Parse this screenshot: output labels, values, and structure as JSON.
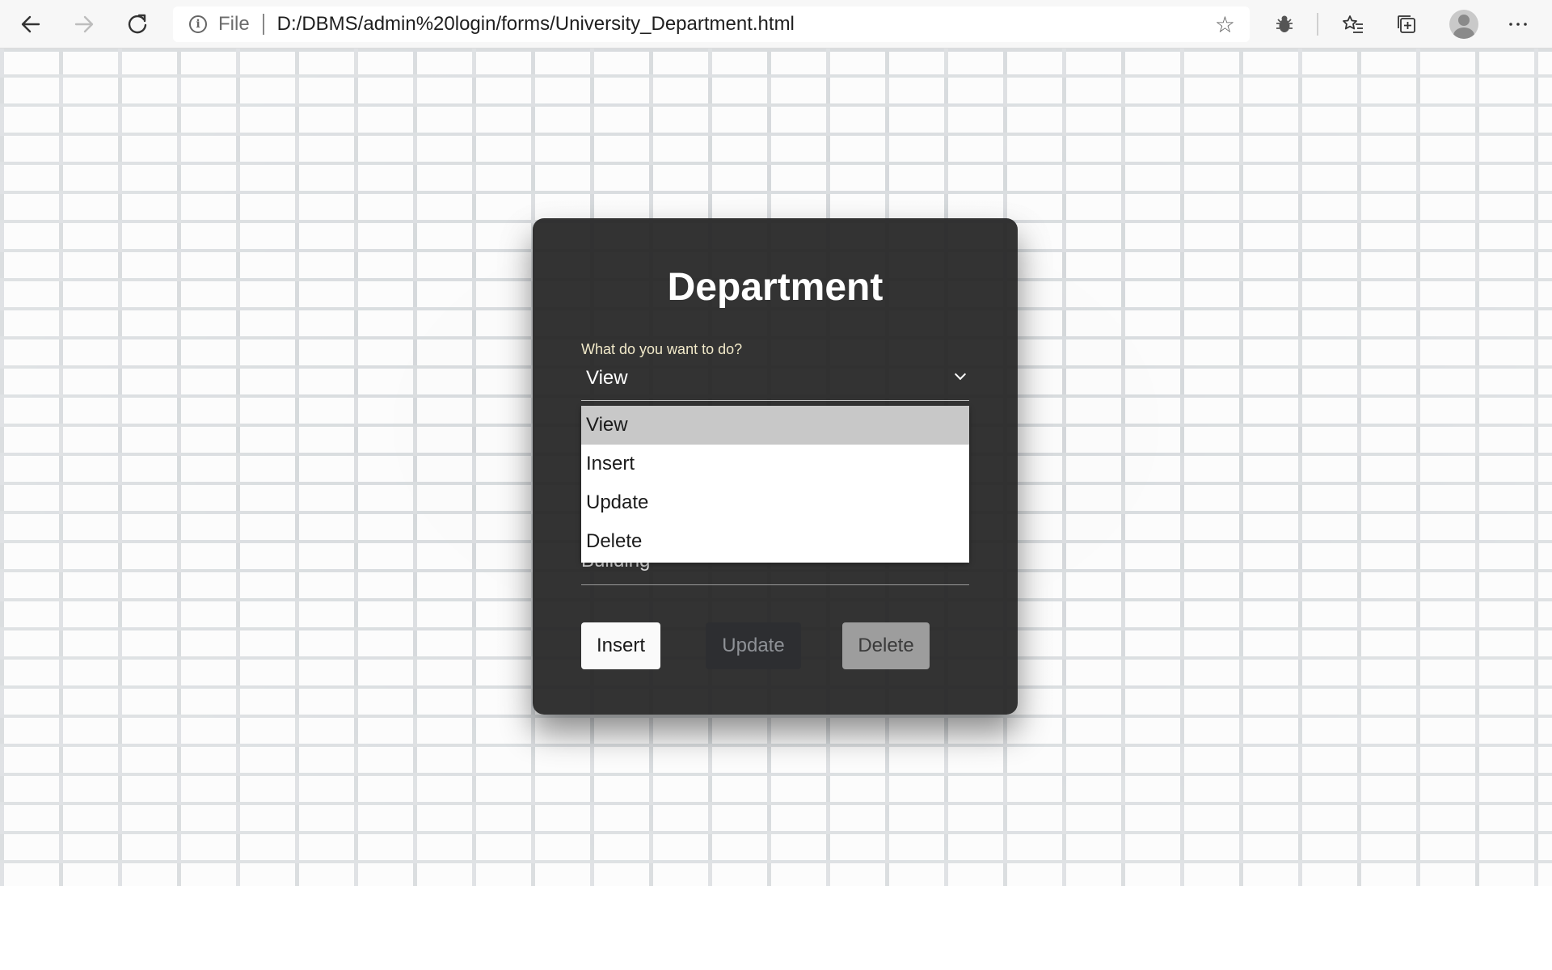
{
  "browser": {
    "url_scheme_label": "File",
    "url": "D:/DBMS/admin%20login/forms/University_Department.html",
    "icons": {
      "back": "arrow-left-icon",
      "forward": "arrow-right-icon",
      "refresh": "refresh-icon",
      "info": "info-icon",
      "star": "star-icon",
      "extension": "bug-icon",
      "favorites": "favorites-icon",
      "collections": "collections-icon",
      "profile": "avatar",
      "menu": "more-icon"
    }
  },
  "form": {
    "title": "Department",
    "action_label": "What do you want to do?",
    "action_value": "View",
    "hidden_field_text": "Building",
    "dropdown_options": [
      "View",
      "Insert",
      "Update",
      "Delete"
    ],
    "buttons": {
      "insert": "Insert",
      "update": "Update",
      "delete": "Delete"
    }
  },
  "colors": {
    "card_background": "#262626",
    "label_color": "#f1e9c9",
    "dropdown_selected": "#c8c8c8"
  }
}
